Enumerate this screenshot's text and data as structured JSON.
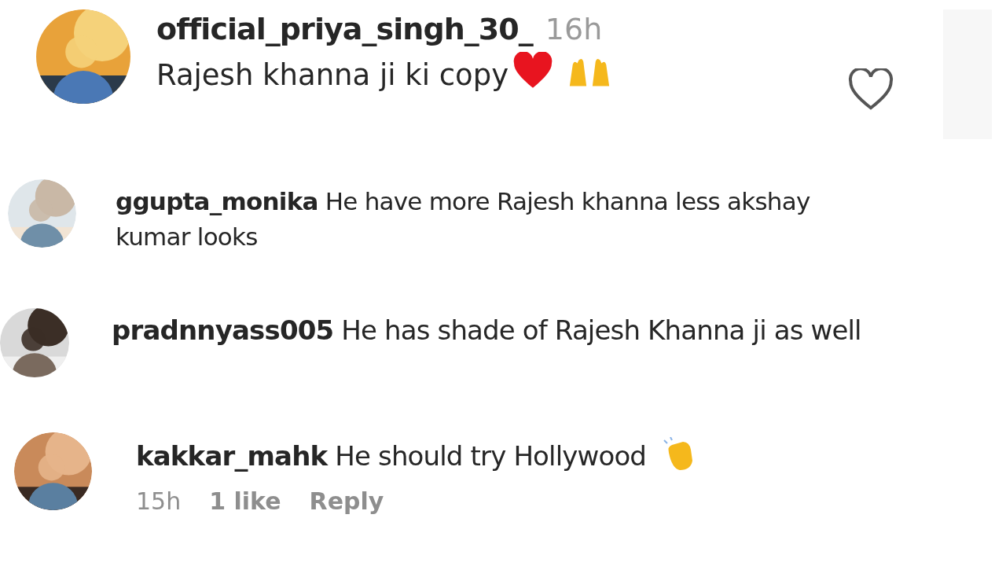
{
  "comments": [
    {
      "username": "official_priya_singh_30_",
      "time": "16h",
      "text": "Rajesh khanna ji ki copy",
      "liked": false
    },
    {
      "username": "ggupta_monika",
      "text": "He have more Rajesh khanna less akshay kumar looks"
    },
    {
      "username": "pradnnyass005",
      "text": "He has shade of Rajesh Khanna ji as well"
    },
    {
      "username": "kakkar_mahk",
      "text": "He should try Hollywood",
      "meta": {
        "time": "15h",
        "likes": "1 like",
        "reply": "Reply"
      }
    }
  ]
}
